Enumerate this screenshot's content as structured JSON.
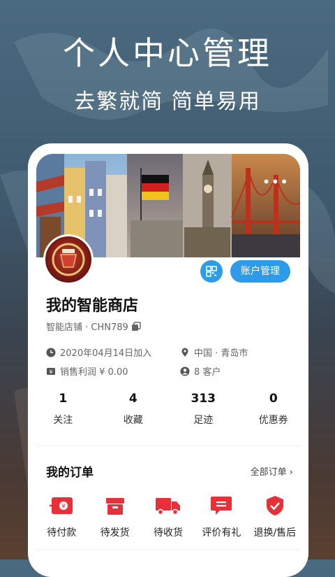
{
  "promo": {
    "title": "个人中心管理",
    "subtitle": "去繁就简  简单易用"
  },
  "profile": {
    "more_icon": "more-dots-icon",
    "qr_icon": "qr-code-icon",
    "account_button": "账户管理",
    "store_name": "我的智能商店",
    "store_id": "智能店铺 · CHN789",
    "copy_icon": "copy-icon",
    "joined": "2020年04月14日加入",
    "location": "中国 · 青岛市",
    "profit": "销售利润 ¥ 0.00",
    "customers": "8 客户"
  },
  "stats": [
    {
      "value": "1",
      "label": "关注"
    },
    {
      "value": "4",
      "label": "收藏"
    },
    {
      "value": "313",
      "label": "足迹"
    },
    {
      "value": "0",
      "label": "优惠券"
    }
  ],
  "orders": {
    "title": "我的订单",
    "all": "全部订单 ›",
    "items": [
      {
        "label": "待付款",
        "icon": "pending-payment-icon"
      },
      {
        "label": "待发货",
        "icon": "pending-shipment-icon"
      },
      {
        "label": "待收货",
        "icon": "delivery-truck-icon"
      },
      {
        "label": "评价有礼",
        "icon": "review-icon"
      },
      {
        "label": "退换/售后",
        "icon": "after-sales-shield-icon"
      }
    ]
  },
  "colors": {
    "accent": "#2d9be8",
    "order_icon": "#e8303a"
  }
}
